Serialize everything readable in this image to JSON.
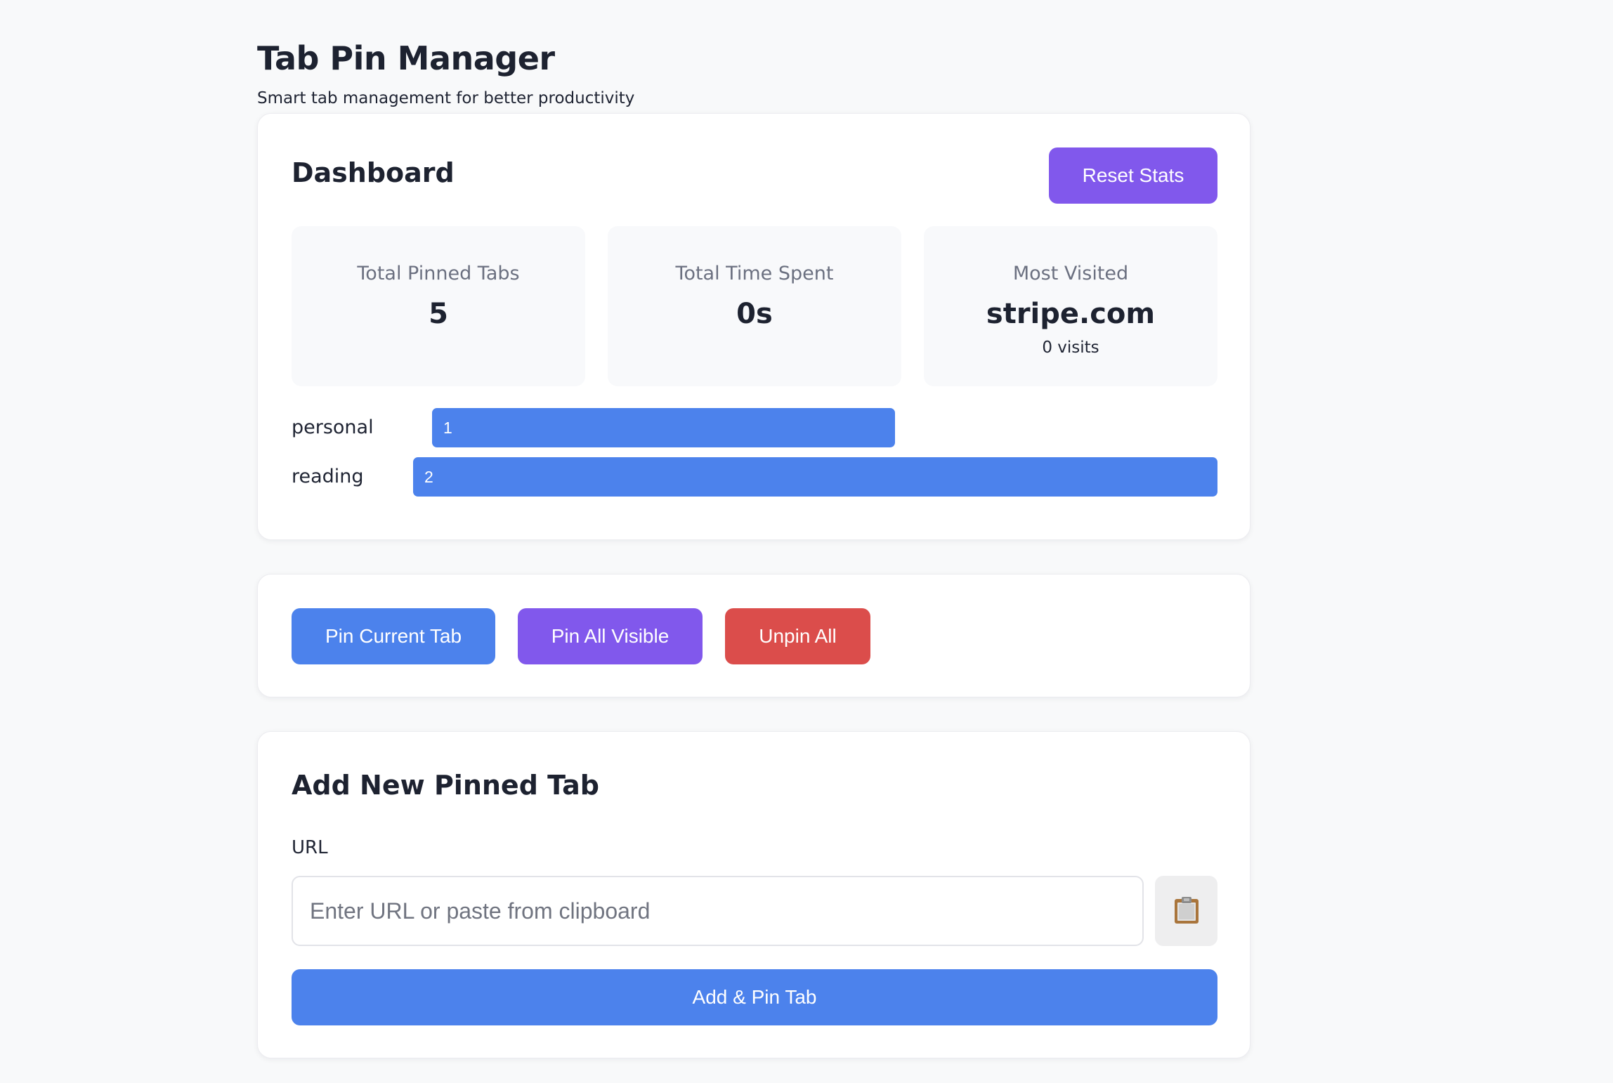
{
  "app": {
    "title": "Tab Pin Manager",
    "subtitle": "Smart tab management for better productivity"
  },
  "dashboard": {
    "title": "Dashboard",
    "reset_label": "Reset Stats",
    "stats": {
      "pinned_label": "Total Pinned Tabs",
      "pinned_value": "5",
      "time_label": "Total Time Spent",
      "time_value": "0s",
      "visited_label": "Most Visited",
      "visited_value": "stripe.com",
      "visited_sub": "0 visits"
    },
    "categories": [
      {
        "name": "personal",
        "count": "1"
      },
      {
        "name": "reading",
        "count": "2"
      }
    ]
  },
  "actions": {
    "pin_current_label": "Pin Current Tab",
    "pin_all_label": "Pin All Visible",
    "unpin_all_label": "Unpin All"
  },
  "add_tab": {
    "title": "Add New Pinned Tab",
    "url_label": "URL",
    "url_value": "",
    "url_placeholder": "Enter URL or paste from clipboard",
    "paste_icon": "clipboard-icon",
    "submit_label": "Add & Pin Tab"
  },
  "colors": {
    "background": "#f8f9fa",
    "primary_blue": "#4c82ec",
    "purple": "#8158ec",
    "danger_red": "#db4d4b"
  }
}
